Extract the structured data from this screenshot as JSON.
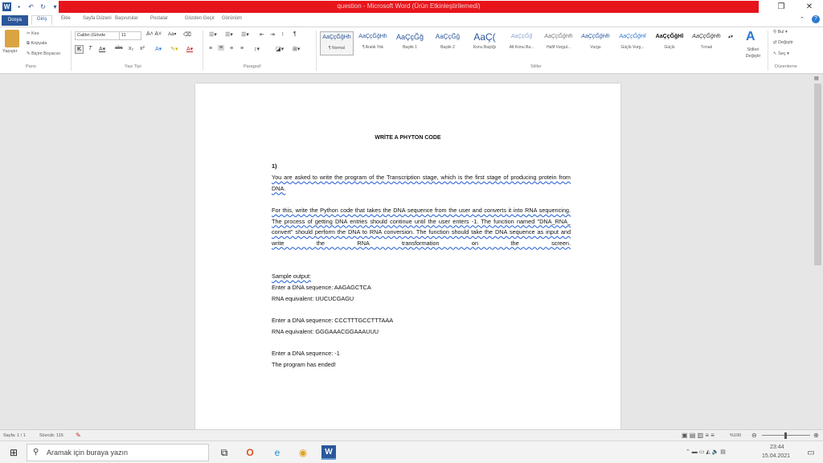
{
  "window": {
    "title": "question - Microsoft Word (Ürün Etkinleştirilemedi)",
    "restore_icon": "restore-icon",
    "close_icon": "close-icon"
  },
  "tabs": [
    "Dosya",
    "Giriş",
    "Ekle",
    "Sayfa Düzeni",
    "Başvurular",
    "Postalar",
    "Gözden Geçir",
    "Görünüm"
  ],
  "ribbon": {
    "clipboard": {
      "paste": "Yapıştır",
      "cut": "Kes",
      "copy": "Kopyala",
      "format_painter": "Biçim Boyacısı",
      "label": "Pano"
    },
    "font": {
      "name": "Calibri (Gövde",
      "size": "11",
      "label": "Yazı Tipi"
    },
    "paragraph": {
      "label": "Paragraf"
    },
    "styles": {
      "label": "Stiller",
      "change": "Stilleri Değiştir",
      "items": [
        {
          "sample": "AaÇçĞğHh",
          "name": "¶ Normal"
        },
        {
          "sample": "AaÇçĞğHh",
          "name": "¶ Aralık Yok"
        },
        {
          "sample": "AaÇçĞğ",
          "name": "Başlık 1"
        },
        {
          "sample": "AaÇçĞğ",
          "name": "Başlık 2"
        },
        {
          "sample": "AaÇ(",
          "name": "Konu Başlığı"
        },
        {
          "sample": "AaÇçĞğ",
          "name": "Alt Konu Ba..."
        },
        {
          "sample": "AaÇçĞğHh",
          "name": "Hafif Vurgul..."
        },
        {
          "sample": "AaÇçĞğHh",
          "name": "Vurgu"
        },
        {
          "sample": "AaÇçĞğHl",
          "name": "Güçlü Vurg..."
        },
        {
          "sample": "AaÇçĞğHl",
          "name": "Güçlü"
        },
        {
          "sample": "AaÇçĞğHh",
          "name": "Tırnak"
        }
      ]
    },
    "editing": {
      "find": "Bul",
      "replace": "Değiştir",
      "select": "Seç",
      "label": "Düzenleme"
    }
  },
  "document": {
    "title": "WRİTE A PHYTON CODE",
    "number": "1)",
    "para1": "You are asked to write the program of the Transcription stage, which is the first stage of producing protein from DNA.",
    "para2": "For this, write the Python code that takes the DNA sequence from the user and converts it into RNA sequencing. The process of getting DNA entries should continue until the user enters -1. The function named \"DNA_RNA_ convert\" should perform the DNA to RNA conversion. The function should take the DNA sequence as input and write the RNA transformation on the screen.",
    "sample_label": "Sample output:",
    "l1": "Enter a DNA sequence: AAGAGCTCA",
    "l2": "RNA equivalent: UUCUCGAGU",
    "l3": "Enter a DNA sequence: CCCTTTGCCTTTAAA",
    "l4": "RNA equivalent: GGGAAACGGAAAUUU",
    "l5": "Enter a DNA sequence: -1",
    "l6": "The program has ended!"
  },
  "status": {
    "page": "Sayfa: 1 / 1",
    "words": "Sözcük: 115",
    "zoom": "%100"
  },
  "taskbar": {
    "search_placeholder": "Aramak için buraya yazın",
    "time": "23:44",
    "date": "15.04.2021"
  }
}
